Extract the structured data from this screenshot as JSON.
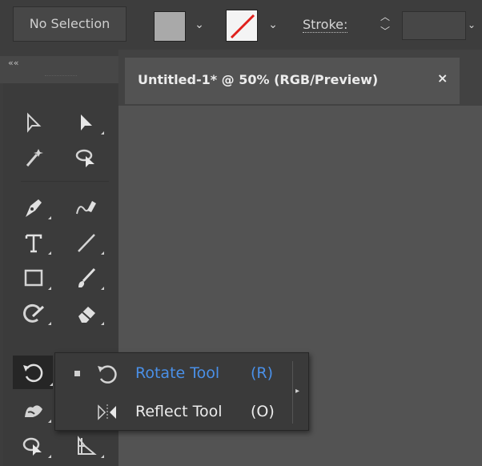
{
  "control_bar": {
    "selection_label": "No Selection",
    "fill_dropdown": "⌄",
    "stroke_dropdown": "⌄",
    "stroke_label": "Stroke:",
    "spinner_up": "︿",
    "spinner_down": "﹀",
    "field_dropdown": "⌄"
  },
  "toolbar": {
    "collapse_icon": "««"
  },
  "document_tab": {
    "title": "Untitled-1* @ 50% (RGB/Preview)",
    "close": "×"
  },
  "flyout": {
    "items": [
      {
        "name": "Rotate Tool",
        "shortcut": "(R)",
        "selected": true
      },
      {
        "name": "Reflect Tool",
        "shortcut": "(O)",
        "selected": false
      }
    ],
    "tearoff": "▸"
  },
  "colors": {
    "highlight": "#4a90e8",
    "panel": "#3d3d3d",
    "canvas": "#535353"
  }
}
